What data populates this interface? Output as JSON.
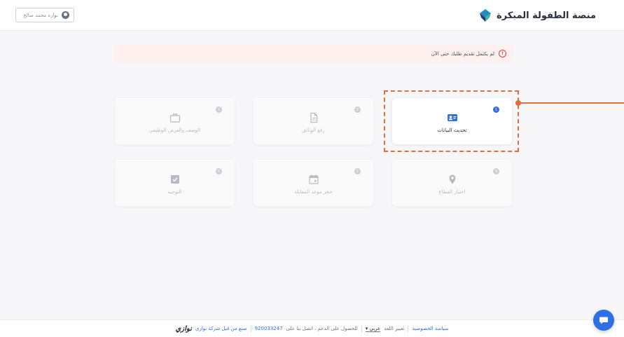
{
  "header": {
    "logo_text": "منصة الطفولة المبكرة",
    "user_name": "نوارة محمد صالح"
  },
  "alert": {
    "icon_glyph": "!",
    "message": "لم يكتمل تقديم طلبك حتى الآن"
  },
  "steps": [
    {
      "number": "1",
      "label": "تحديث البيانات",
      "icon": "id-card-icon",
      "state": "active"
    },
    {
      "number": "2",
      "label": "رفع الوثائق",
      "icon": "document-icon",
      "state": "disabled"
    },
    {
      "number": "3",
      "label": "الوصف والعرض الوظيفي",
      "icon": "briefcase-icon",
      "state": "disabled"
    },
    {
      "number": "4",
      "label": "اختيار القطاع",
      "icon": "location-pin-icon",
      "state": "disabled"
    },
    {
      "number": "5",
      "label": "حجز موعد المقابلة",
      "icon": "calendar-icon",
      "state": "disabled"
    },
    {
      "number": "6",
      "label": "التوجيه",
      "icon": "checkbox-icon",
      "state": "disabled"
    }
  ],
  "footer": {
    "privacy": "سياسة الخصوصية",
    "language_label": "تغيير اللغة",
    "language_value": "عربي",
    "support_text": "للحصول على الدعم ، اتصل بنا على",
    "phone": "920033247",
    "made_by": "صنع من قبل شركة نوازي",
    "brand": "نوازي"
  },
  "colors": {
    "accent": "#2f6fe4",
    "highlight": "#e06f3c",
    "alert_bg": "#fdf0ef",
    "alert_icon": "#d0463b"
  }
}
